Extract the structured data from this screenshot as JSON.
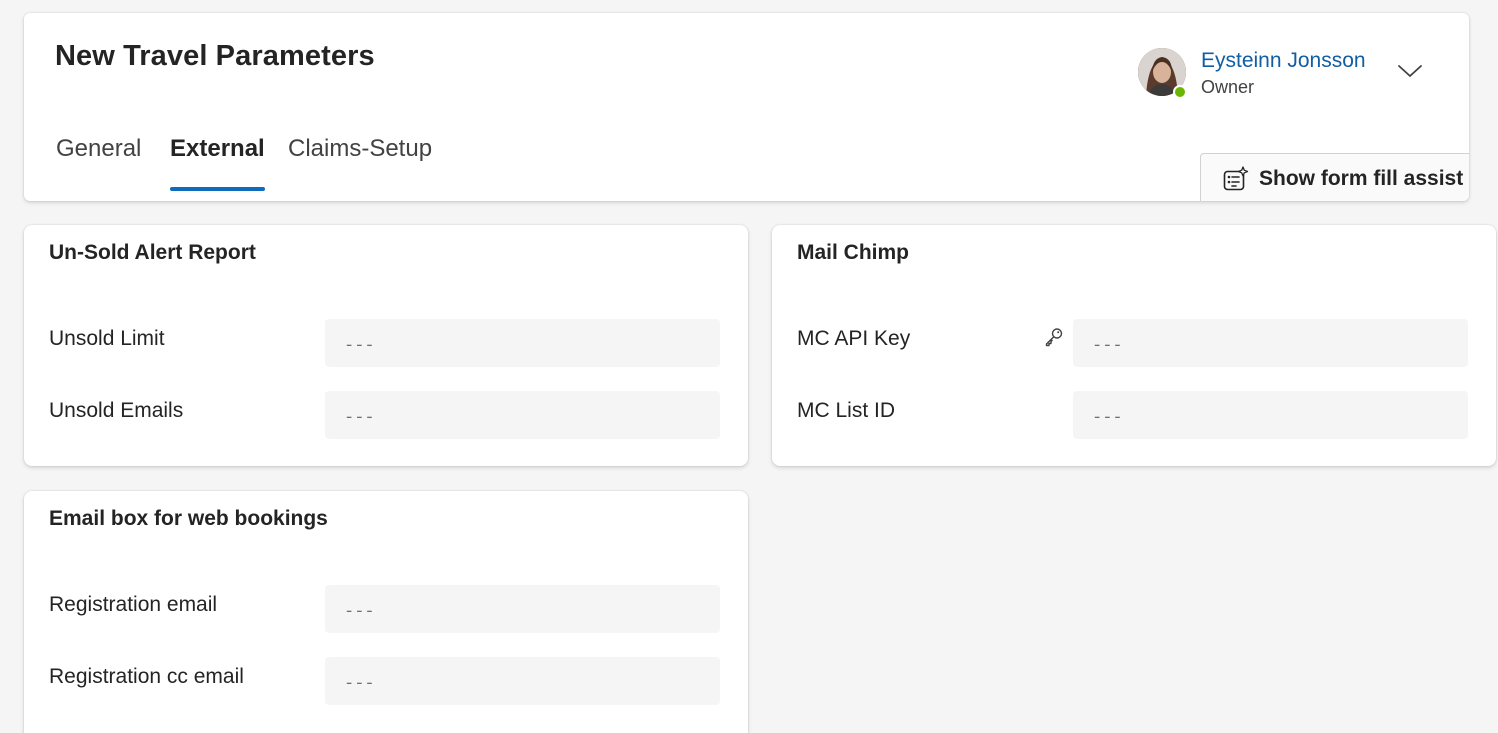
{
  "header": {
    "title": "New Travel Parameters",
    "owner": {
      "name": "Eysteinn Jonsson",
      "role": "Owner",
      "presence_color": "#6bb700"
    },
    "tabs": [
      {
        "label": "General",
        "active": false
      },
      {
        "label": "External",
        "active": true
      },
      {
        "label": "Claims-Setup",
        "active": false
      }
    ],
    "assist_button": {
      "label": "Show form fill assist",
      "icon": "form-assist-sparkle-icon"
    }
  },
  "sections": {
    "unsold": {
      "title": "Un-Sold Alert Report",
      "fields": [
        {
          "label": "Unsold Limit",
          "placeholder": "---",
          "value": ""
        },
        {
          "label": "Unsold Emails",
          "placeholder": "---",
          "value": ""
        }
      ]
    },
    "mailchimp": {
      "title": "Mail Chimp",
      "fields": [
        {
          "label": "MC API Key",
          "placeholder": "---",
          "value": "",
          "icon": "key-icon"
        },
        {
          "label": "MC List ID",
          "placeholder": "---",
          "value": ""
        }
      ]
    },
    "emailbox": {
      "title": "Email box for web bookings",
      "fields": [
        {
          "label": "Registration email",
          "placeholder": "---",
          "value": ""
        },
        {
          "label": "Registration cc email",
          "placeholder": "---",
          "value": ""
        }
      ]
    }
  },
  "colors": {
    "accent": "#0f6cbd",
    "link": "#115ea3",
    "page_background": "#f5f5f5"
  }
}
